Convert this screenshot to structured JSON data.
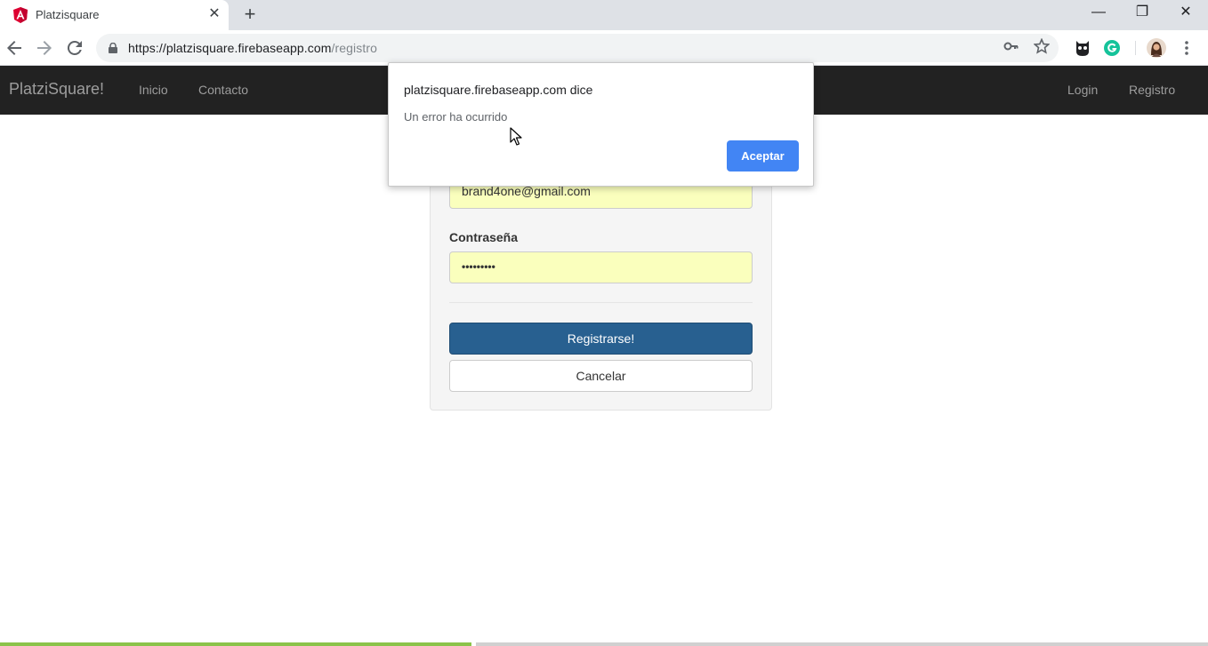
{
  "browser": {
    "tab_title": "Platzisquare",
    "tab_close": "✕",
    "new_tab": "+",
    "window_minimize": "—",
    "window_restore": "❐",
    "window_close": "✕",
    "url_base": "https://platzisquare.firebaseapp.com",
    "url_path": "/registro",
    "icons": [
      "angular-favicon",
      "back-icon",
      "forward-icon",
      "reload-icon",
      "lock-icon",
      "key-icon",
      "star-icon",
      "owl-extension-icon",
      "grammarly-extension-icon",
      "profile-avatar",
      "menu-icon"
    ]
  },
  "navbar": {
    "brand": "PlatziSquare!",
    "links_left": [
      "Inicio",
      "Contacto"
    ],
    "links_right": [
      "Login",
      "Registro"
    ]
  },
  "form": {
    "email_value": "brand4one@gmail.com",
    "password_label": "Contraseña",
    "password_value": "•••••••••",
    "submit_label": "Registrarse!",
    "cancel_label": "Cancelar"
  },
  "dialog": {
    "title": "platzisquare.firebaseapp.com dice",
    "message": "Un error ha ocurrido",
    "ok_label": "Aceptar"
  },
  "video_progress": 0.39,
  "colors": {
    "navbar_bg": "#222222",
    "primary_button": "#286090",
    "dialog_button": "#4285f4",
    "autofill_bg": "#faffbd",
    "progress": "#8bc34a"
  }
}
